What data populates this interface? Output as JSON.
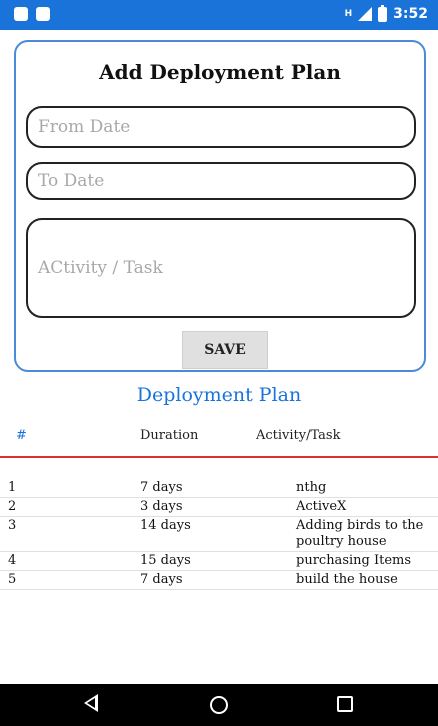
{
  "status_bar": {
    "time": "3:52",
    "network": "H",
    "left_icons": [
      "notification-icon",
      "android-icon"
    ],
    "right_icons": [
      "signal-icon",
      "battery-icon"
    ],
    "background_color": "#1a73d9"
  },
  "form": {
    "title": "Add Deployment Plan",
    "from_date_placeholder": "From Date",
    "to_date_placeholder": "To Date",
    "activity_placeholder": "ACtivity / Task",
    "save_label": "SAVE",
    "border_color": "#4a8ad6"
  },
  "plan": {
    "title": "Deployment Plan",
    "accent_color": "#1a73d9",
    "divider_color": "#d9322c",
    "columns": [
      "#",
      "Duration",
      "Activity/Task"
    ],
    "rows": [
      {
        "num": "1",
        "duration": "7 days",
        "activity": "nthg"
      },
      {
        "num": "2",
        "duration": "3 days",
        "activity": "ActiveX"
      },
      {
        "num": "3",
        "duration": "14 days",
        "activity": "Adding birds to the poultry house"
      },
      {
        "num": "4",
        "duration": "15 days",
        "activity": "purchasing Items"
      },
      {
        "num": "5",
        "duration": "7 days",
        "activity": "build the house"
      }
    ]
  },
  "nav_bar": {
    "icons": [
      "back-icon",
      "home-icon",
      "recent-apps-icon"
    ]
  }
}
